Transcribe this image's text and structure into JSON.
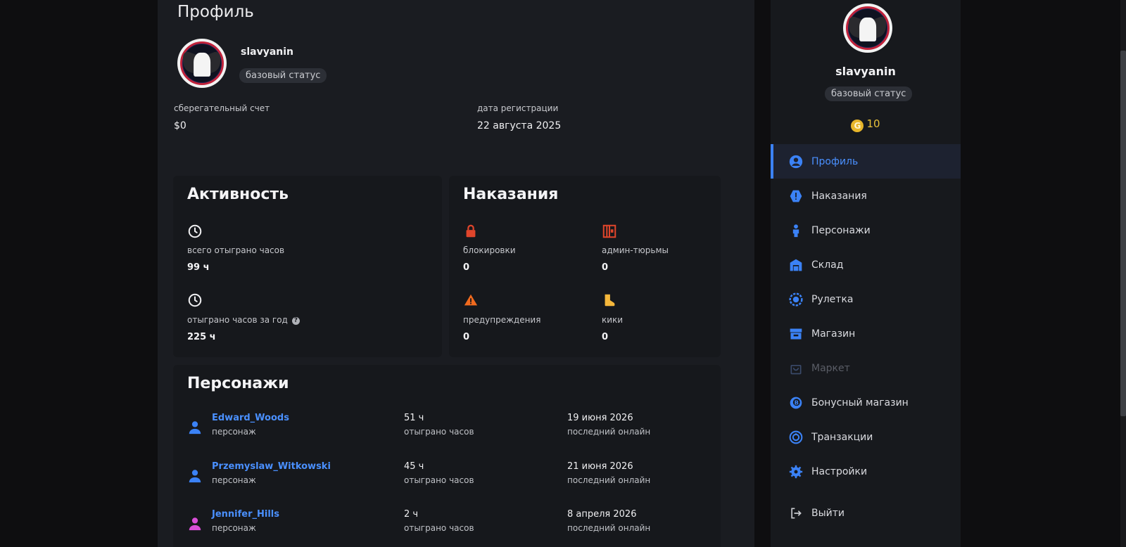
{
  "page": {
    "title": "Профиль"
  },
  "profile": {
    "username": "slavyanin",
    "status": "базовый статус",
    "savings_label": "сберегательный счет",
    "savings_value": "$0",
    "reg_label": "дата регистрации",
    "reg_value": "22 августа 2025"
  },
  "activity": {
    "title": "Активность",
    "total_label": "всего отыграно часов",
    "total_value": "99 ч",
    "year_label": "отыграно часов за год",
    "year_value": "225 ч"
  },
  "punishments": {
    "title": "Наказания",
    "items": [
      {
        "label": "блокировки",
        "value": "0",
        "icon": "lock-icon",
        "color": "#e0452b"
      },
      {
        "label": "админ-тюрьмы",
        "value": "0",
        "icon": "jail-icon",
        "color": "#e0452b"
      },
      {
        "label": "предупреждения",
        "value": "0",
        "icon": "warning-icon",
        "color": "#f06a1e"
      },
      {
        "label": "кики",
        "value": "0",
        "icon": "boot-icon",
        "color": "#f5b73b"
      }
    ]
  },
  "characters": {
    "title": "Персонажи",
    "rows": [
      {
        "name": "Edward_Woods",
        "type": "персонаж",
        "hours": "51 ч",
        "hours_label": "отыграно часов",
        "last": "19 июня 2026",
        "last_label": "последний онлайн",
        "icon_color": "#3b82f6"
      },
      {
        "name": "Przemyslaw_Witkowski",
        "type": "персонаж",
        "hours": "45 ч",
        "hours_label": "отыграно часов",
        "last": "21 июня 2026",
        "last_label": "последний онлайн",
        "icon_color": "#3b82f6"
      },
      {
        "name": "Jennifer_Hills",
        "type": "персонаж",
        "hours": "2 ч",
        "hours_label": "отыграно часов",
        "last": "8 апреля 2026",
        "last_label": "последний онлайн",
        "icon_color": "#d94fd8"
      }
    ]
  },
  "sidebar": {
    "username": "slavyanin",
    "status": "базовый статус",
    "coins": "10",
    "coin_letter": "G",
    "items": [
      {
        "label": "Профиль",
        "icon": "user-circle-icon",
        "active": true
      },
      {
        "label": "Наказания",
        "icon": "alert-hexagon-icon"
      },
      {
        "label": "Персонажи",
        "icon": "person-icon"
      },
      {
        "label": "Склад",
        "icon": "warehouse-icon"
      },
      {
        "label": "Рулетка",
        "icon": "roulette-icon"
      },
      {
        "label": "Магазин",
        "icon": "store-icon"
      },
      {
        "label": "Маркет",
        "icon": "bag-icon",
        "disabled": true
      },
      {
        "label": "Бонусный магазин",
        "icon": "bonus-icon"
      },
      {
        "label": "Транзакции",
        "icon": "transactions-icon"
      },
      {
        "label": "Настройки",
        "icon": "gear-icon"
      }
    ],
    "logout": "Выйти"
  },
  "colors": {
    "accent": "#3b82f6",
    "link": "#4a90ff",
    "coin": "#e8b62a"
  }
}
